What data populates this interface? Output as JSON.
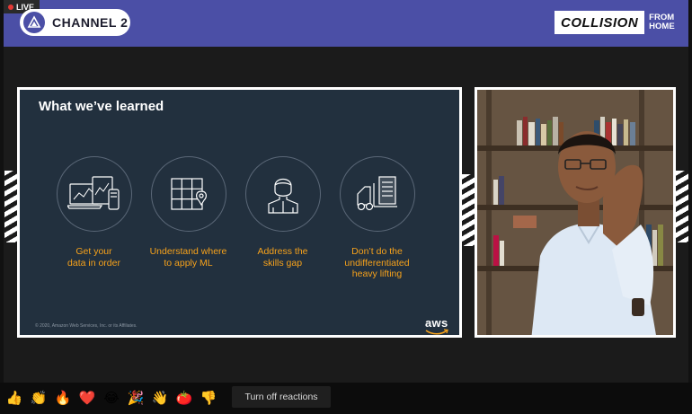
{
  "header": {
    "live_label": "LIVE",
    "channel_name": "CHANNEL 2",
    "event_logo_word": "COLLISION",
    "event_logo_from": "FROM",
    "event_logo_home": "HOME"
  },
  "slide": {
    "title": "What we’ve learned",
    "pillars": [
      {
        "icon": "devices-icon",
        "label": "Get your\ndata in order"
      },
      {
        "icon": "grid-location-icon",
        "label": "Understand where\nto apply ML"
      },
      {
        "icon": "person-icon",
        "label": "Address the\nskills gap"
      },
      {
        "icon": "forklift-icon",
        "label": "Don’t do the\nundifferentiated\nheavy lifting"
      }
    ],
    "copyright": "© 2020, Amazon Web Services, Inc. or its Affiliates.",
    "brand": "aws",
    "accent_color": "#f7a21b"
  },
  "reactions": {
    "items": [
      {
        "name": "thumbs-up",
        "glyph": "👍"
      },
      {
        "name": "clapping-hands",
        "glyph": "👏"
      },
      {
        "name": "fire",
        "glyph": "🔥"
      },
      {
        "name": "heart",
        "glyph": "❤️"
      },
      {
        "name": "laughing-face",
        "glyph": "😂"
      },
      {
        "name": "party-popper",
        "glyph": "🎉"
      },
      {
        "name": "waving-hand",
        "glyph": "👋"
      },
      {
        "name": "tomato",
        "glyph": "🍅"
      },
      {
        "name": "thumbs-down",
        "glyph": "👎"
      }
    ],
    "turn_off_label": "Turn off reactions"
  }
}
